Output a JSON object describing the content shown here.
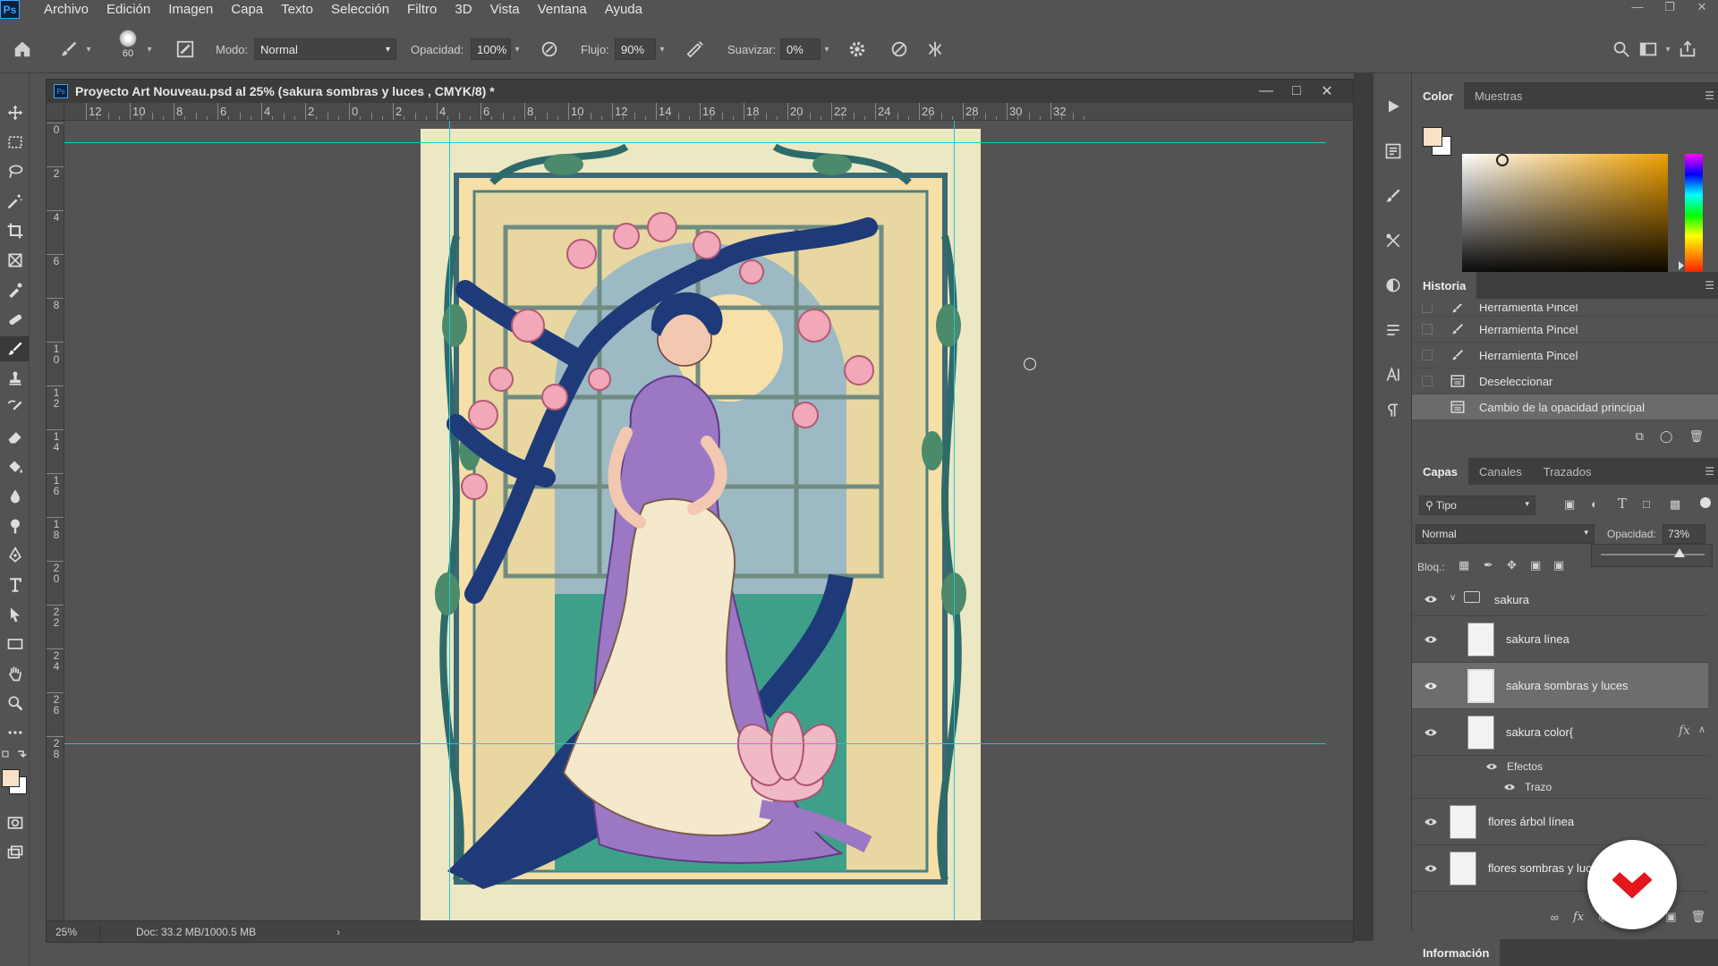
{
  "app": {
    "logo_text": "Ps"
  },
  "menu": [
    "Archivo",
    "Edición",
    "Imagen",
    "Capa",
    "Texto",
    "Selección",
    "Filtro",
    "3D",
    "Vista",
    "Ventana",
    "Ayuda"
  ],
  "options": {
    "brush_size": "60",
    "mode_label": "Modo:",
    "mode_value": "Normal",
    "opacity_label": "Opacidad:",
    "opacity_value": "100%",
    "flow_label": "Flujo:",
    "flow_value": "90%",
    "smooth_label": "Suavizar:",
    "smooth_value": "0%"
  },
  "document": {
    "title": "Proyecto Art Nouveau.psd al 25% (sakura sombras y luces , CMYK/8) *",
    "zoom": "25%",
    "doc_info": "Doc: 33.2 MB/1000.5 MB",
    "ruler_top": [
      "12",
      "10",
      "8",
      "6",
      "4",
      "2",
      "0",
      "2",
      "4",
      "6",
      "8",
      "10",
      "12",
      "14",
      "16",
      "18",
      "20",
      "22",
      "24",
      "26",
      "28",
      "30",
      "32"
    ],
    "ruler_left": [
      "0",
      "2",
      "4",
      "6",
      "8",
      "1\n0",
      "1\n2",
      "1\n4",
      "1\n6",
      "1\n8",
      "2\n0",
      "2\n2",
      "2\n4",
      "2\n6",
      "2\n8"
    ]
  },
  "color_panel": {
    "tabs": [
      "Color",
      "Muestras"
    ],
    "foreground": "#f9e1c8",
    "background": "#ffffff",
    "hue_color": "#f0a000"
  },
  "history_panel": {
    "title": "Historia",
    "items": [
      {
        "label": "Herramienta Pincel",
        "icon": "brush-icon"
      },
      {
        "label": "Herramienta Pincel",
        "icon": "brush-icon"
      },
      {
        "label": "Herramienta Pincel",
        "icon": "brush-icon"
      },
      {
        "label": "Deseleccionar",
        "icon": "document-icon"
      },
      {
        "label": "Cambio de la opacidad principal",
        "icon": "document-icon"
      }
    ]
  },
  "layers_panel": {
    "tabs": [
      "Capas",
      "Canales",
      "Trazados"
    ],
    "filter_label": "Tipo",
    "blend_mode": "Normal",
    "opacity_label": "Opacidad:",
    "opacity_value": "73%",
    "lock_label": "Bloq.:",
    "group_name": "sakura",
    "layers": [
      "sakura línea",
      "sakura sombras y luces",
      "sakura color{",
      "flores árbol línea",
      "flores sombras y luc"
    ],
    "effects_label": "Efectos",
    "stroke_label": "Trazo",
    "fx_label": "fx"
  },
  "info_panel": {
    "title": "Información"
  },
  "colors": {
    "guide": "#27c4d0",
    "brand_red": "#e3161c"
  }
}
